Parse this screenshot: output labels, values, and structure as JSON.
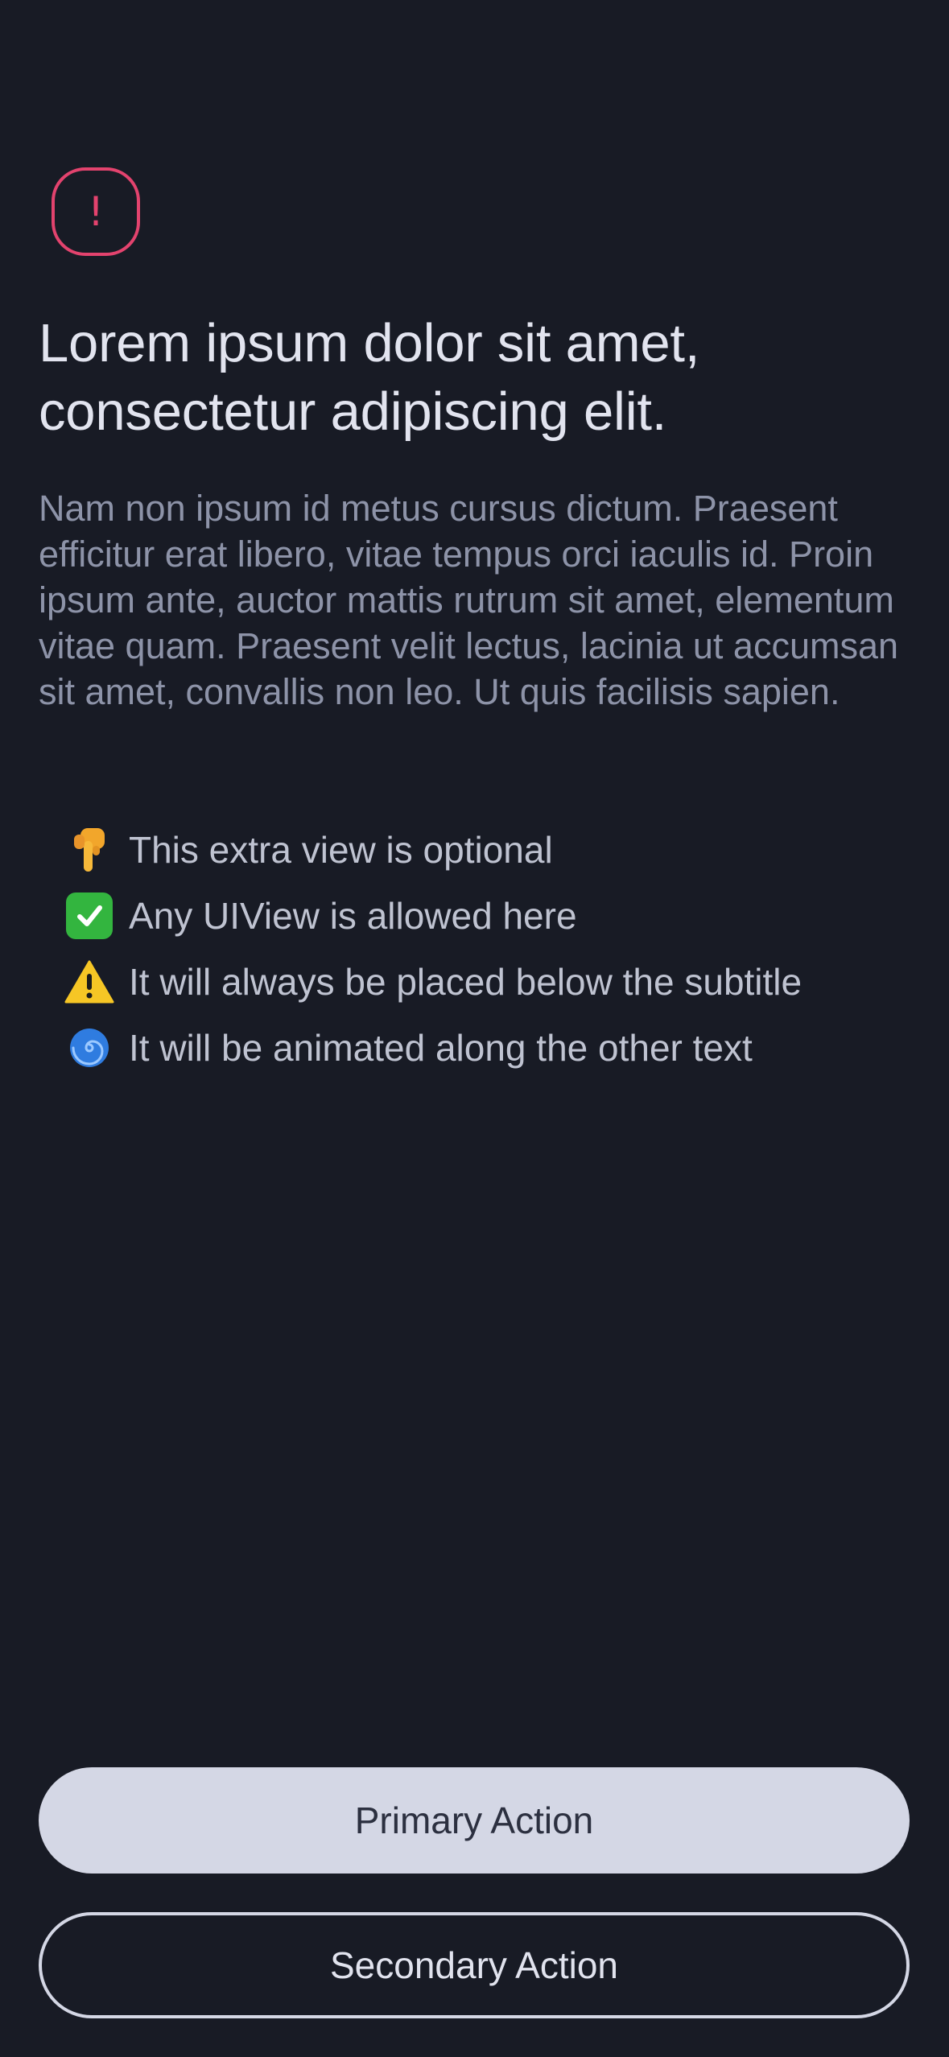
{
  "alert": {
    "icon": "exclamation-icon",
    "glyph": "!",
    "color": "#e3436e"
  },
  "title": "Lorem ipsum dolor sit amet, consectetur adipiscing elit.",
  "subtitle": "Nam non ipsum id metus cursus dictum. Praesent efficitur erat libero, vitae tempus orci iaculis id. Proin ipsum ante, auctor mattis rutrum sit amet, elementum vitae quam. Praesent velit lectus, lacinia ut accumsan sit amet, convallis non leo. Ut quis facilisis sapien.",
  "extra_view": {
    "items": [
      {
        "icon": "pointing-down-hand-icon",
        "text": "This extra view is optional"
      },
      {
        "icon": "check-mark-button-icon",
        "text": "Any UIView is allowed here"
      },
      {
        "icon": "warning-icon",
        "text": "It will always be placed below the subtitle"
      },
      {
        "icon": "cyclone-icon",
        "text": "It will be animated along the other text"
      }
    ]
  },
  "actions": {
    "primary_label": "Primary Action",
    "secondary_label": "Secondary Action"
  },
  "colors": {
    "background": "#181b25",
    "accent": "#e3436e",
    "button_fill": "#d4d7e5"
  }
}
